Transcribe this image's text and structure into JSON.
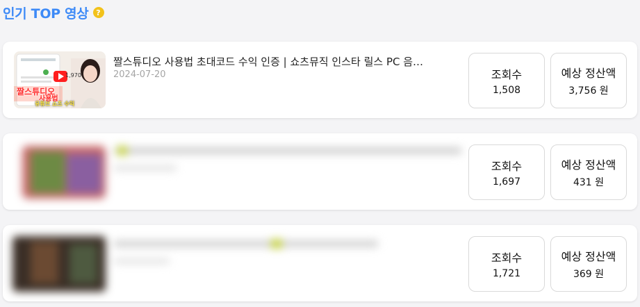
{
  "section": {
    "title": "인기 TOP 영상",
    "help_icon": "question-circle-icon",
    "help_icon_glyph": "?"
  },
  "labels": {
    "views": "조회수",
    "revenue": "예상 정산액"
  },
  "colors": {
    "title_accent": "#3d8af7",
    "help_icon_bg": "#f2c21b"
  },
  "videos": [
    {
      "title": "짤스튜디오 사용법 초대코드 수익 인증 | 쇼츠뮤직 인스타 릴스 PC 음…",
      "date": "2024-07-20",
      "views": "1,508",
      "revenue": "3,756 원",
      "thumbnail": {
        "caption_main": "짤스튜디오",
        "caption_sub": "사용법",
        "caption_bottom": "유튜브 쇼츠 수익",
        "number": "1,970"
      }
    },
    {
      "title": "",
      "date": "",
      "views": "1,697",
      "revenue": "431 원",
      "blurred": true
    },
    {
      "title": "",
      "date": "",
      "views": "1,721",
      "revenue": "369 원",
      "blurred": true
    }
  ]
}
